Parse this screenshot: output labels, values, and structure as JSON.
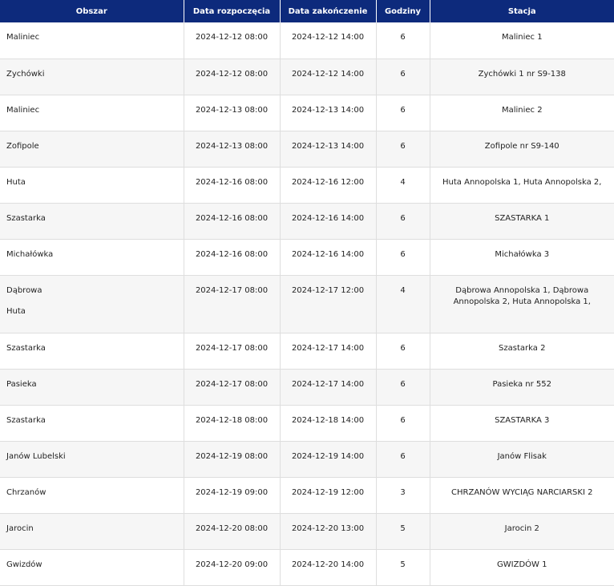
{
  "table": {
    "headers": {
      "area": "Obszar",
      "start": "Data rozpoczęcia",
      "end": "Data zakończenie",
      "hours": "Godziny",
      "station": "Stacja"
    },
    "rows": [
      {
        "areas": [
          "Maliniec"
        ],
        "start": "2024-12-12 08:00",
        "end": "2024-12-12 14:00",
        "hours": "6",
        "station": "Maliniec 1"
      },
      {
        "areas": [
          "Zychówki"
        ],
        "start": "2024-12-12 08:00",
        "end": "2024-12-12 14:00",
        "hours": "6",
        "station": "Zychówki 1 nr S9-138"
      },
      {
        "areas": [
          "Maliniec"
        ],
        "start": "2024-12-13 08:00",
        "end": "2024-12-13 14:00",
        "hours": "6",
        "station": "Maliniec 2"
      },
      {
        "areas": [
          "Zofipole"
        ],
        "start": "2024-12-13 08:00",
        "end": "2024-12-13 14:00",
        "hours": "6",
        "station": "Zofipole nr S9-140"
      },
      {
        "areas": [
          "Huta"
        ],
        "start": "2024-12-16 08:00",
        "end": "2024-12-16 12:00",
        "hours": "4",
        "station": "Huta Annopolska 1, Huta Annopolska 2,"
      },
      {
        "areas": [
          "Szastarka"
        ],
        "start": "2024-12-16 08:00",
        "end": "2024-12-16 14:00",
        "hours": "6",
        "station": "SZASTARKA 1"
      },
      {
        "areas": [
          "Michałówka"
        ],
        "start": "2024-12-16 08:00",
        "end": "2024-12-16 14:00",
        "hours": "6",
        "station": "Michałówka 3"
      },
      {
        "areas": [
          "Dąbrowa",
          "Huta"
        ],
        "start": "2024-12-17 08:00",
        "end": "2024-12-17 12:00",
        "hours": "4",
        "station": "Dąbrowa Annopolska 1, Dąbrowa Annopolska 2, Huta Annopolska 1,"
      },
      {
        "areas": [
          "Szastarka"
        ],
        "start": "2024-12-17 08:00",
        "end": "2024-12-17 14:00",
        "hours": "6",
        "station": "Szastarka 2"
      },
      {
        "areas": [
          "Pasieka"
        ],
        "start": "2024-12-17 08:00",
        "end": "2024-12-17 14:00",
        "hours": "6",
        "station": "Pasieka nr 552"
      },
      {
        "areas": [
          "Szastarka"
        ],
        "start": "2024-12-18 08:00",
        "end": "2024-12-18 14:00",
        "hours": "6",
        "station": "SZASTARKA 3"
      },
      {
        "areas": [
          "Janów Lubelski"
        ],
        "start": "2024-12-19 08:00",
        "end": "2024-12-19 14:00",
        "hours": "6",
        "station": "Janów Flisak"
      },
      {
        "areas": [
          "Chrzanów"
        ],
        "start": "2024-12-19 09:00",
        "end": "2024-12-19 12:00",
        "hours": "3",
        "station": "CHRZANÓW WYCIĄG NARCIARSKI 2"
      },
      {
        "areas": [
          "Jarocin"
        ],
        "start": "2024-12-20 08:00",
        "end": "2024-12-20 13:00",
        "hours": "5",
        "station": "Jarocin 2"
      },
      {
        "areas": [
          "Gwizdów"
        ],
        "start": "2024-12-20 09:00",
        "end": "2024-12-20 14:00",
        "hours": "5",
        "station": "GWIZDÓW 1"
      }
    ]
  }
}
